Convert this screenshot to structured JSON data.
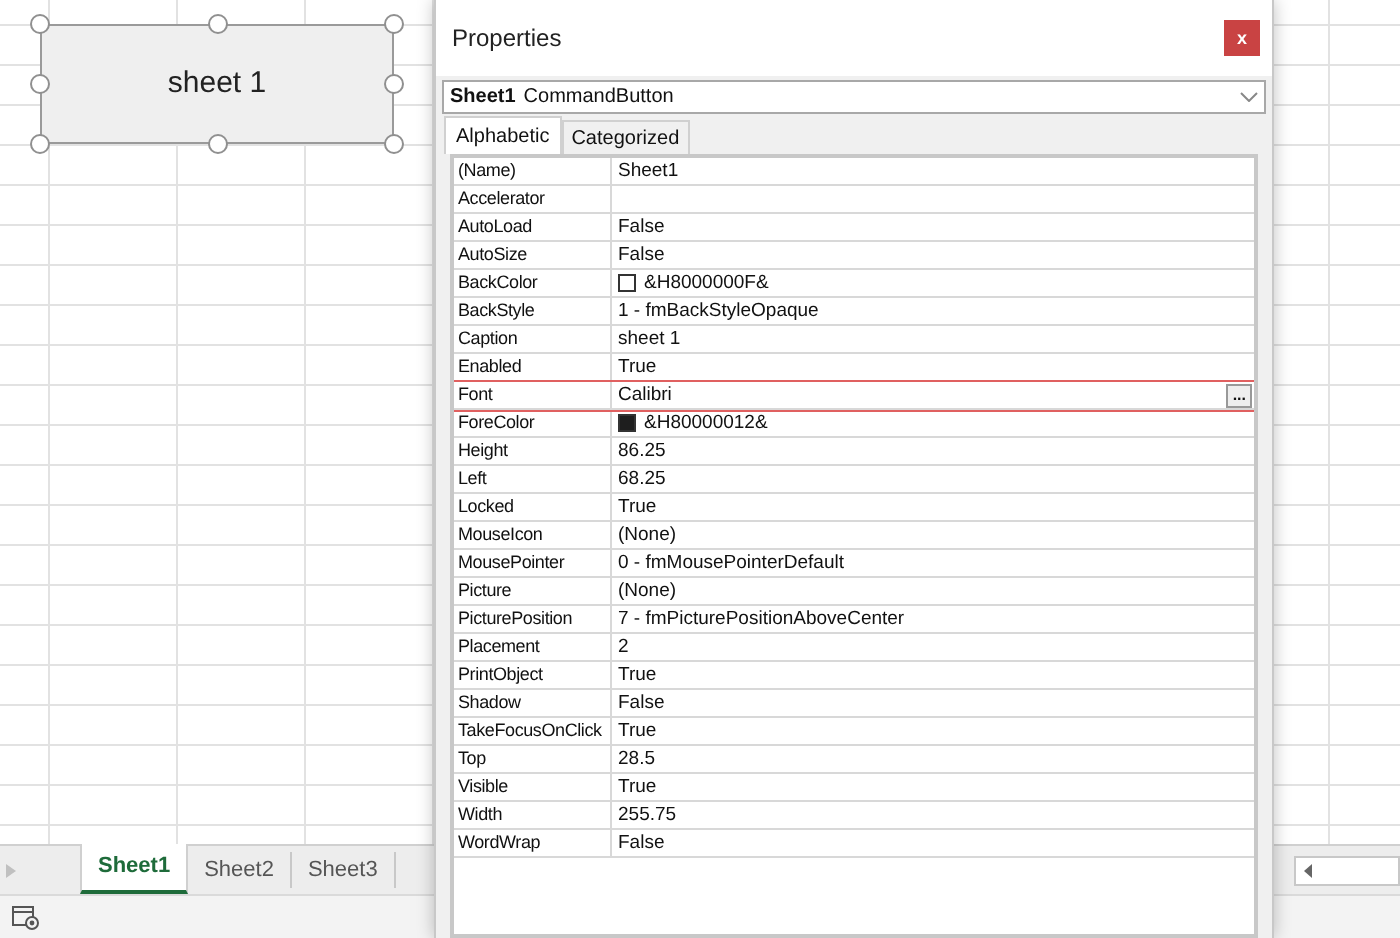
{
  "sheet": {
    "command_button": {
      "label": "sheet 1"
    },
    "tabs": [
      {
        "label": "Sheet1",
        "selected": true
      },
      {
        "label": "Sheet2",
        "selected": false
      },
      {
        "label": "Sheet3",
        "selected": false
      }
    ]
  },
  "properties_window": {
    "title": "Properties",
    "close": "x",
    "object_selector": {
      "name": "Sheet1",
      "type": "CommandButton"
    },
    "tabs": [
      {
        "label": "Alphabetic",
        "selected": true
      },
      {
        "label": "Categorized",
        "selected": false
      }
    ],
    "rows": [
      {
        "name": "(Name)",
        "value": "Sheet1",
        "kind": "text",
        "selected": false
      },
      {
        "name": "Accelerator",
        "value": "",
        "kind": "text",
        "selected": false
      },
      {
        "name": "AutoLoad",
        "value": "False",
        "kind": "text",
        "selected": false
      },
      {
        "name": "AutoSize",
        "value": "False",
        "kind": "text",
        "selected": false
      },
      {
        "name": "BackColor",
        "value": "&H8000000F&",
        "kind": "color",
        "color": "#ffffff",
        "selected": false
      },
      {
        "name": "BackStyle",
        "value": "1 - fmBackStyleOpaque",
        "kind": "text",
        "selected": false
      },
      {
        "name": "Caption",
        "value": "sheet 1",
        "kind": "text",
        "selected": false
      },
      {
        "name": "Enabled",
        "value": "True",
        "kind": "text",
        "selected": false
      },
      {
        "name": "Font",
        "value": "Calibri",
        "kind": "dialog",
        "button": "...",
        "selected": true
      },
      {
        "name": "ForeColor",
        "value": "&H80000012&",
        "kind": "color",
        "color": "#1e1e1e",
        "selected": false
      },
      {
        "name": "Height",
        "value": "86.25",
        "kind": "text",
        "selected": false
      },
      {
        "name": "Left",
        "value": "68.25",
        "kind": "text",
        "selected": false
      },
      {
        "name": "Locked",
        "value": "True",
        "kind": "text",
        "selected": false
      },
      {
        "name": "MouseIcon",
        "value": "(None)",
        "kind": "text",
        "selected": false
      },
      {
        "name": "MousePointer",
        "value": "0 - fmMousePointerDefault",
        "kind": "text",
        "selected": false
      },
      {
        "name": "Picture",
        "value": "(None)",
        "kind": "text",
        "selected": false
      },
      {
        "name": "PicturePosition",
        "value": "7 - fmPicturePositionAboveCenter",
        "kind": "text",
        "selected": false
      },
      {
        "name": "Placement",
        "value": "2",
        "kind": "text",
        "selected": false
      },
      {
        "name": "PrintObject",
        "value": "True",
        "kind": "text",
        "selected": false
      },
      {
        "name": "Shadow",
        "value": "False",
        "kind": "text",
        "selected": false
      },
      {
        "name": "TakeFocusOnClick",
        "value": "True",
        "kind": "text",
        "selected": false
      },
      {
        "name": "Top",
        "value": "28.5",
        "kind": "text",
        "selected": false
      },
      {
        "name": "Visible",
        "value": "True",
        "kind": "text",
        "selected": false
      },
      {
        "name": "Width",
        "value": "255.75",
        "kind": "text",
        "selected": false
      },
      {
        "name": "WordWrap",
        "value": "False",
        "kind": "text",
        "selected": false
      }
    ]
  }
}
